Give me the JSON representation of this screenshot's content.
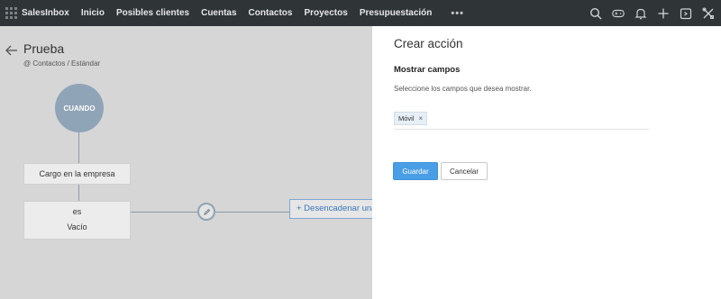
{
  "topbar": {
    "items": [
      "SalesInbox",
      "Inicio",
      "Posibles clientes",
      "Cuentas",
      "Contactos",
      "Proyectos",
      "Presupuestación"
    ],
    "more": "•••",
    "icons": [
      "search-icon",
      "gamepad-icon",
      "bell-icon",
      "plus-icon",
      "calendar-icon",
      "tools-icon"
    ],
    "bg_color": "#2f3437"
  },
  "workflow": {
    "title": "Prueba",
    "breadcrumb": "@ Contactos / Estándar",
    "when_label": "CUANDO",
    "field_label": "Cargo en la empresa",
    "condition_operator": "es",
    "condition_value": "Vacío",
    "trigger_label": "+ Desencadenar una"
  },
  "panel": {
    "title": "Crear acción",
    "section_title": "Mostrar campos",
    "section_hint": "Seleccione los campos que desea mostrar.",
    "tags": [
      {
        "label": "Móvil",
        "remove": "×"
      }
    ],
    "save_label": "Guardar",
    "cancel_label": "Cancelar",
    "accent_color": "#4a9ee6"
  }
}
